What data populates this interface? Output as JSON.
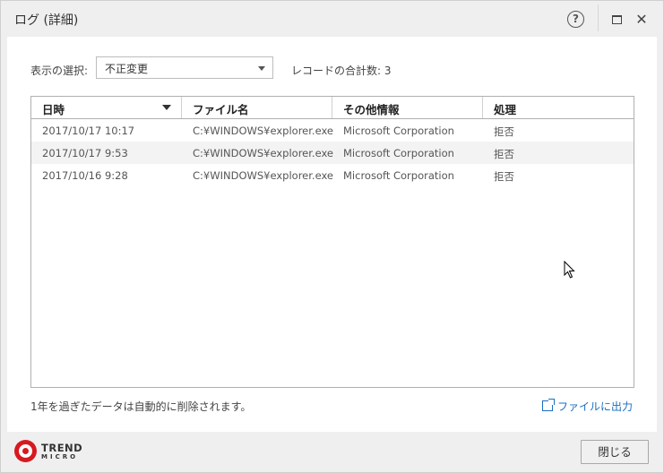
{
  "window": {
    "title": "ログ (詳細)",
    "help_icon": "question-circle-icon",
    "maximize_icon": "maximize-icon",
    "close_icon": "close-icon",
    "help_glyph": "?",
    "close_glyph": "✕"
  },
  "filter": {
    "label": "表示の選択:",
    "selected": "不正変更",
    "record_count_label": "レコードの合計数: 3"
  },
  "table": {
    "columns": [
      "日時",
      "ファイル名",
      "その他情報",
      "処理"
    ],
    "sorted_column": "日時",
    "rows": [
      [
        "2017/10/17 10:17",
        "C:¥WINDOWS¥explorer.exe",
        "Microsoft Corporation",
        "拒否"
      ],
      [
        "2017/10/17 9:53",
        "C:¥WINDOWS¥explorer.exe",
        "Microsoft Corporation",
        "拒否"
      ],
      [
        "2017/10/16 9:28",
        "C:¥WINDOWS¥explorer.exe",
        "Microsoft Corporation",
        "拒否"
      ]
    ]
  },
  "footer": {
    "note": "1年を過ぎたデータは自動的に削除されます。",
    "export_label": "ファイルに出力",
    "export_icon": "external-link-icon"
  },
  "brand": {
    "line1": "TREND",
    "line2": "MICRO",
    "color": "#d71920"
  },
  "buttons": {
    "close_label": "閉じる"
  },
  "colors": {
    "link": "#1a6fc2",
    "row_alt": "#f3f3f3",
    "chrome": "#efefef"
  }
}
